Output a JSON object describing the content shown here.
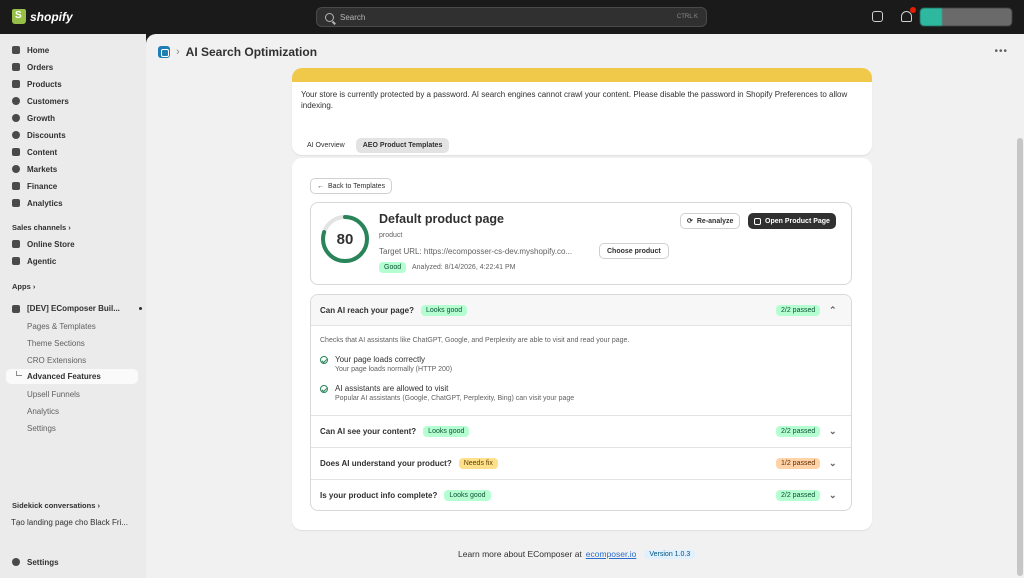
{
  "topbar": {
    "logo": "shopify",
    "search_placeholder": "Search",
    "shortcut": "CTRL  K",
    "notification_count": "1"
  },
  "sidebar": {
    "items": [
      {
        "label": "Home",
        "icon": "home-icon"
      },
      {
        "label": "Orders",
        "icon": "orders-icon"
      },
      {
        "label": "Products",
        "icon": "tag-icon"
      },
      {
        "label": "Customers",
        "icon": "person-icon"
      },
      {
        "label": "Growth",
        "icon": "growth-icon"
      },
      {
        "label": "Discounts",
        "icon": "discount-icon"
      },
      {
        "label": "Content",
        "icon": "content-icon"
      },
      {
        "label": "Markets",
        "icon": "globe-icon"
      },
      {
        "label": "Finance",
        "icon": "bank-icon"
      },
      {
        "label": "Analytics",
        "icon": "chart-icon"
      }
    ],
    "sales_channels_label": "Sales channels",
    "channels": [
      {
        "label": "Online Store",
        "icon": "store-icon"
      },
      {
        "label": "Agentic",
        "icon": "agentic-icon"
      }
    ],
    "apps_label": "Apps",
    "app_name": "[DEV] EComposer Buil...",
    "app_sub": [
      "Pages & Templates",
      "Theme Sections",
      "CRO Extensions",
      "Advanced Features",
      "Upsell Funnels",
      "Analytics",
      "Settings"
    ],
    "sidekick_label": "Sidekick conversations",
    "recent_conversation": "Tạo landing page cho Black Fri...",
    "settings_label": "Settings"
  },
  "main": {
    "page_title": "AI Search Optimization",
    "banner_text": "Your store is currently protected by a password. AI search engines cannot crawl your content. Please disable the password in Shopify Preferences to allow indexing.",
    "tabs": [
      "AI Overview",
      "AEO Product Templates"
    ],
    "back_label": "Back to Templates",
    "summary": {
      "score": "80",
      "title": "Default product page",
      "type": "product",
      "target_url": "Target URL: https://ecomposser-cs-dev.myshopify.co...",
      "choose_label": "Choose product",
      "status": "Good",
      "analyzed": "Analyzed: 8/14/2026, 4:22:41 PM",
      "reanalyze_label": "Re-analyze",
      "open_label": "Open Product Page",
      "score_color": "#29845a"
    },
    "checks": [
      {
        "question": "Can AI reach your page?",
        "badge": "Looks good",
        "passed": "2/2 passed"
      },
      {
        "question": "Can AI see your content?",
        "badge": "Looks good",
        "passed": "2/2 passed"
      },
      {
        "question": "Does AI understand your product?",
        "badge": "Needs fix",
        "passed": "1/2 passed"
      },
      {
        "question": "Is your product info complete?",
        "badge": "Looks good",
        "passed": "2/2 passed"
      }
    ],
    "expanded": {
      "description": "Checks that AI assistants like ChatGPT, Google, and Perplexity are able to visit and read your page.",
      "items": [
        {
          "title": "Your page loads correctly",
          "sub": "Your page loads normally (HTTP 200)"
        },
        {
          "title": "AI assistants are allowed to visit",
          "sub": "Popular AI assistants (Google, ChatGPT, Perplexity, Bing) can visit your page"
        }
      ]
    },
    "footer": {
      "text": "Learn more about EComposer at",
      "link": "ecomposer.io",
      "version": "Version 1.0.3"
    }
  }
}
